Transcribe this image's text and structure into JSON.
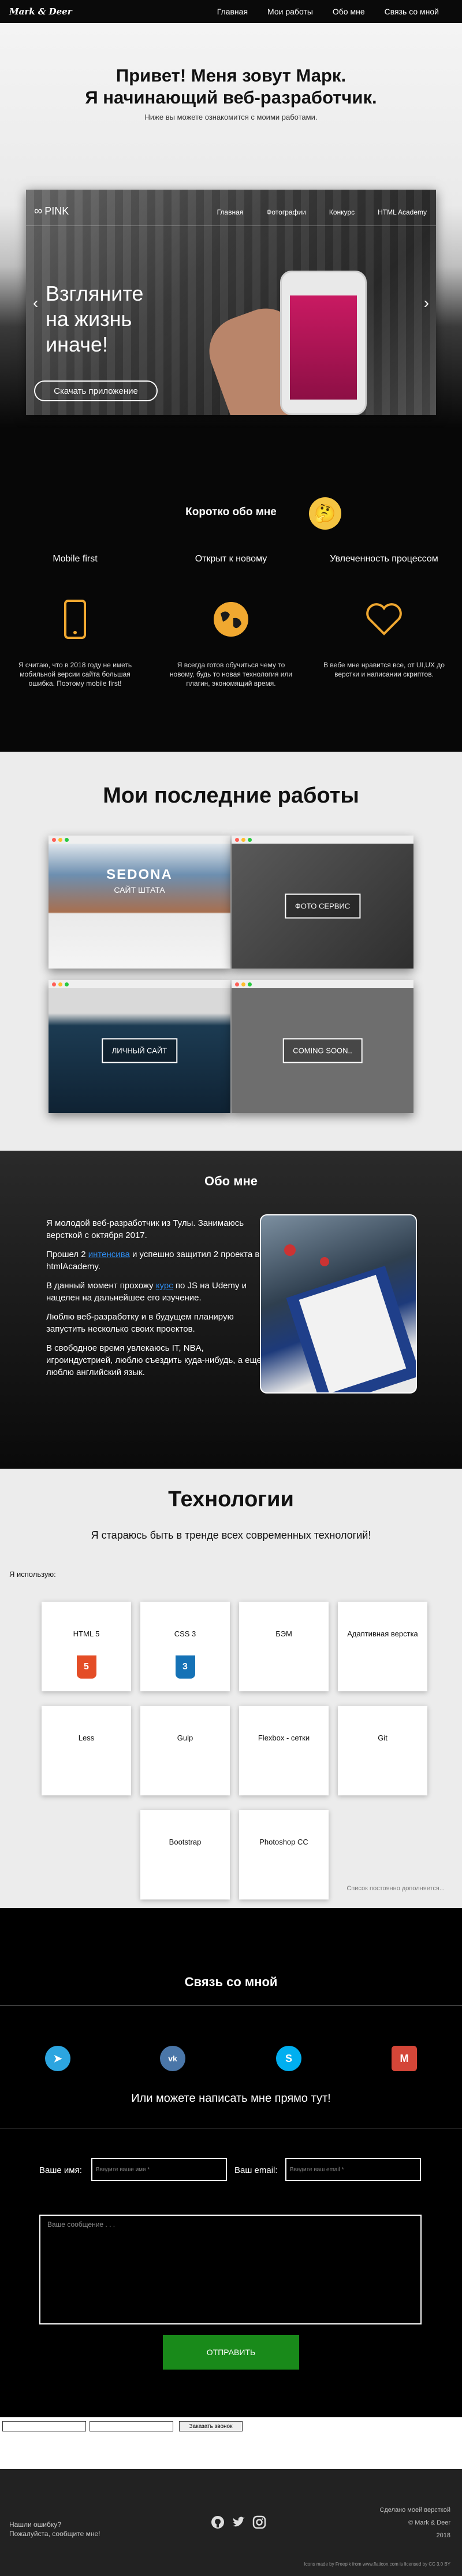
{
  "nav": {
    "logo": "Mark & Deer",
    "links": [
      "Главная",
      "Мои работы",
      "Обо мне",
      "Связь со мной"
    ]
  },
  "hero": {
    "title_line1": "Привет! Меня зовут Марк.",
    "title_line2": "Я начинающий веб-разработчик.",
    "subtitle": "Ниже вы можете ознакомится с моими работами.",
    "slider": {
      "brand": "PINK",
      "nav": [
        "Главная",
        "Фотографии",
        "Конкурс",
        "HTML Academy"
      ],
      "headline_1": "Взгляните",
      "headline_2": "на жизнь",
      "headline_3": "иначе!",
      "button": "Скачать приложение",
      "prev": "‹",
      "next": "›"
    }
  },
  "short": {
    "title": "Коротко обо мне",
    "emoji": "🤔",
    "cols": [
      {
        "heading": "Mobile first",
        "text": "Я считаю, что в 2018 году не иметь мобильной версии сайта большая ошибка. Поэтому mobile first!"
      },
      {
        "heading": "Открыт к новому",
        "text": "Я всегда готов обучиться чему то новому, будь то новая технология или плагин, экономящий время."
      },
      {
        "heading": "Увлеченность процессом",
        "text": "В вебе мне нравится все, от UI,UX до верстки и написании скриптов."
      }
    ]
  },
  "works": {
    "title": "Мои последние работы",
    "cards": [
      {
        "label": "SEDONA",
        "sublabel": "САЙТ ШТАТА",
        "color": "#3b6d9c"
      },
      {
        "label": "ФОТО СЕРВИС",
        "color": "#333333"
      },
      {
        "label": "ЛИЧНЫЙ САЙТ",
        "color": "#18344a"
      },
      {
        "label": "COMING SOON..",
        "color": "#6e6e6e"
      }
    ]
  },
  "about": {
    "title": "Обо мне",
    "p1": "Я молодой веб-разработчик из Тулы. Занимаюсь версткой с октября 2017.",
    "p2_a": "Прошел 2",
    "p2_link1": "интенсива",
    "p2_b": "и успешно защитил 2 проекта в htmlAcademy.",
    "p3_a": "В данный момент прохожу",
    "p3_link": "курс",
    "p3_b": "по JS на Udemy и нацелен на дальнейшее его изучение.",
    "p4": "Люблю веб-разработку и в будущем планирую запустить несколько своих проектов.",
    "p5": "В свободное время увлекаюсь IT, NBA, игроиндустрией, люблю съездить куда-нибудь, а еще люблю английский язык."
  },
  "tech": {
    "title": "Технологии",
    "subtitle": "Я стараюсь быть в тренде всех современных технологий!",
    "use_label": "Я использую:",
    "tiles": [
      {
        "label": "HTML 5",
        "icon": "5",
        "icon_color": "#e44d26"
      },
      {
        "label": "CSS 3",
        "icon": "3",
        "icon_color": "#1572b6"
      },
      {
        "label": "БЭМ"
      },
      {
        "label": "Адаптивная верстка"
      },
      {
        "label": "Less"
      },
      {
        "label": "Gulp"
      },
      {
        "label": "Flexbox - сетки"
      },
      {
        "label": "Git"
      },
      {
        "label": "Bootstrap"
      },
      {
        "label": "Photoshop CC"
      }
    ],
    "note": "Список постоянно дополняется..."
  },
  "contact": {
    "title": "Связь со мной",
    "socials": [
      {
        "name": "telegram",
        "glyph": "➤",
        "color": "#2ca5e0"
      },
      {
        "name": "vk",
        "glyph": "vk",
        "color": "#4a76a8"
      },
      {
        "name": "skype",
        "glyph": "S",
        "color": "#00aff0"
      },
      {
        "name": "gmail",
        "glyph": "M",
        "color": "#d44638"
      }
    ],
    "write": "Или можете написать мне прямо тут!",
    "name_label": "Ваше имя:",
    "name_placeholder": "Введите ваше имя *",
    "email_label": "Ваш email:",
    "email_placeholder": "Введите ваш email *",
    "message_placeholder": "Ваше сообщение . . .",
    "send": "ОТПРАВИТЬ"
  },
  "strip": {
    "subscribe": "Заказать звонок"
  },
  "footer": {
    "left_1": "Нашли ошибку?",
    "left_2": "Пожалуйста, сообщите мне!",
    "right_1": "Сделано моей версткой",
    "right_2": "© Mark & Deer",
    "right_3": "2018",
    "credit": "Icons made by Freepik from www.flaticon.com is licensed by CC 3.0 BY"
  }
}
